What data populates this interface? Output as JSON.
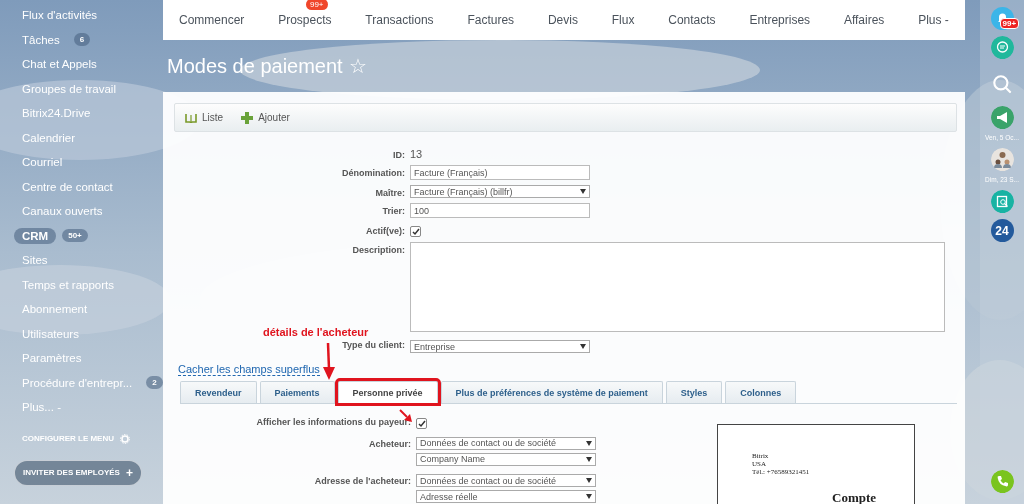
{
  "sidebar": {
    "items": [
      {
        "label": "Flux d'activités",
        "selected": false
      },
      {
        "label": "Tâches",
        "badge": "6",
        "selected": false
      },
      {
        "label": "Chat et Appels",
        "selected": false
      },
      {
        "label": "Groupes de travail",
        "selected": false
      },
      {
        "label": "Bitrix24.Drive",
        "selected": false
      },
      {
        "label": "Calendrier",
        "selected": false
      },
      {
        "label": "Courriel",
        "selected": false
      },
      {
        "label": "Centre de contact",
        "selected": false
      },
      {
        "label": "Canaux ouverts",
        "selected": false
      },
      {
        "label": "CRM",
        "badge": "50+",
        "selected": true
      },
      {
        "label": "Sites",
        "selected": false
      },
      {
        "label": "Temps et rapports",
        "selected": false
      },
      {
        "label": "Abonnement",
        "selected": false
      },
      {
        "label": "Utilisateurs",
        "selected": false
      },
      {
        "label": "Paramètres",
        "selected": false
      },
      {
        "label": "Procédure d'entrepr...",
        "badge": "2",
        "selected": false
      },
      {
        "label": "Plus... -",
        "selected": false
      }
    ],
    "configure": "CONFIGURER LE MENU",
    "invite": "INVITER DES EMPLOYÉS",
    "invite_icon": "+"
  },
  "topnav": {
    "items": [
      {
        "label": "Commencer"
      },
      {
        "label": "Prospects",
        "badge": "99+"
      },
      {
        "label": "Transactions"
      },
      {
        "label": "Factures"
      },
      {
        "label": "Devis"
      },
      {
        "label": "Flux"
      },
      {
        "label": "Contacts"
      },
      {
        "label": "Entreprises"
      },
      {
        "label": "Affaires"
      },
      {
        "label": "Plus -"
      }
    ]
  },
  "page_title": "Modes de paiement",
  "title_star": "☆",
  "toolbar": [
    {
      "label": "Liste",
      "kind": "list"
    },
    {
      "label": "Ajouter",
      "kind": "add"
    }
  ],
  "form": {
    "fields": [
      {
        "kind": "static",
        "label": "ID:",
        "value": "13"
      },
      {
        "kind": "text",
        "label": "Dénomination:",
        "value": "Facture (Français)"
      },
      {
        "kind": "select",
        "label": "Maître:",
        "value": "Facture (Français) (billfr)"
      },
      {
        "kind": "text",
        "label": "Trier:",
        "value": "100"
      },
      {
        "kind": "checkbox",
        "label": "Actif(ve):",
        "checked": true
      },
      {
        "kind": "textarea",
        "label": "Description:"
      },
      {
        "kind": "select",
        "label": "Type du client:",
        "value": "Entreprise"
      }
    ],
    "toggle_link": "Cacher les champs superflus",
    "annotation": "détails de l'acheteur",
    "tabs": [
      {
        "label": "Revendeur",
        "selected": false,
        "highlighted": false
      },
      {
        "label": "Paiements",
        "selected": false,
        "highlighted": false
      },
      {
        "label": "Personne privée",
        "selected": true,
        "highlighted": true
      },
      {
        "label": "Plus de préférences de système de paiement",
        "selected": false,
        "highlighted": false
      },
      {
        "label": "Styles",
        "selected": false,
        "highlighted": false
      },
      {
        "label": "Colonnes",
        "selected": false,
        "highlighted": false
      }
    ],
    "payer": {
      "label": "Afficher les informations du payeur:",
      "checked": true,
      "rows": [
        {
          "label": "Acheteur:",
          "selects": [
            "Données de contact ou de société",
            "Company Name"
          ]
        },
        {
          "label": "Adresse de l'acheteur:",
          "selects": [
            "Données de contact ou de société",
            "Adresse réelle"
          ]
        }
      ]
    },
    "preview": {
      "lines": [
        "Bitrix",
        "USA",
        "Tél.: +76589321451"
      ],
      "heading": "Compte"
    }
  },
  "rightbar": {
    "notification_badge": "99+",
    "dates": [
      "Ven, 5 Oc...",
      "Dim, 23 S..."
    ],
    "app_label": "24"
  }
}
